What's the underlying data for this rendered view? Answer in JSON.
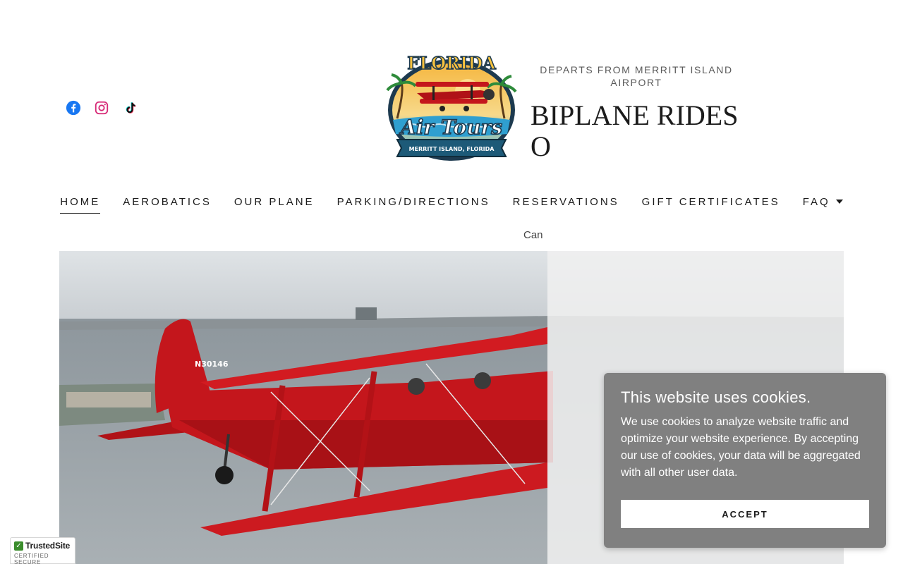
{
  "header": {
    "social": [
      {
        "name": "facebook-icon",
        "color": "#1877f2"
      },
      {
        "name": "instagram-icon",
        "color": "#e1306c"
      },
      {
        "name": "tiktok-icon",
        "color": "#111111"
      }
    ],
    "logo": {
      "top_text": "FLORIDA",
      "main_text": "Air Tours",
      "ribbon_text": "MERRITT ISLAND, FLORIDA"
    }
  },
  "nav": {
    "items": [
      {
        "label": "HOME",
        "active": true
      },
      {
        "label": "AEROBATICS"
      },
      {
        "label": "OUR PLANE"
      },
      {
        "label": "PARKING/DIRECTIONS"
      },
      {
        "label": "RESERVATIONS"
      },
      {
        "label": "GIFT CERTIFICATES"
      },
      {
        "label": "FAQ",
        "has_dropdown": true
      }
    ]
  },
  "hero": {
    "eyebrow": "DEPARTS FROM MERRITT ISLAND AIRPORT",
    "title_line1": "BIPLANE RIDES",
    "title_line2": "O",
    "sub_text": "Can",
    "tail_number": "N30146"
  },
  "cookie": {
    "title": "This website uses cookies.",
    "body": "We use cookies to analyze website traffic and optimize your website experience. By accepting our use of cookies, your data will be aggregated with all other user data.",
    "accept_label": "ACCEPT"
  },
  "badge": {
    "name": "TrustedSite",
    "sub": "CERTIFIED SECURE"
  },
  "colors": {
    "plane_red": "#c4161c",
    "cookie_bg": "#808080",
    "text_dark": "#1b1b1b"
  }
}
